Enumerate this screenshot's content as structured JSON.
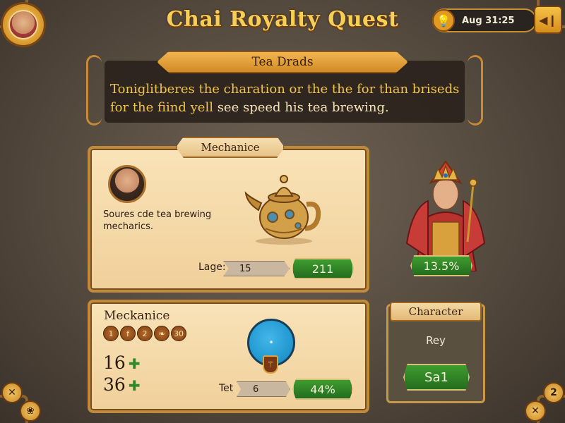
{
  "header": {
    "title": "Chai Royalty Quest",
    "clock": "Aug 31:25",
    "bulb_icon": "lightbulb-icon",
    "pause_icon": "pause-icon"
  },
  "banner": {
    "tab_label": "Tea Drads",
    "text_line1": "Toniglitberes the charation or the the for than briseds",
    "text_line2_highlight": "for the fiind yell",
    "text_line2_rest": " see speed his tea brewing."
  },
  "mechanics_panel": {
    "tab_label": "Mechanice",
    "description": "Soures cde tea brewing mecharics.",
    "bar_label": "Lage:",
    "bar_value": "15",
    "green_value": "211"
  },
  "queen": {
    "percent": "13.5%"
  },
  "mechanics_panel2": {
    "title": "Meckanice",
    "coins": [
      "1",
      "f",
      "2",
      "❧",
      "30"
    ],
    "stat1": "16",
    "stat2": "36",
    "orb_label": "•",
    "bar_label": "Tet",
    "bar_value": "6",
    "green_value": "44%"
  },
  "character_panel": {
    "tab_label": "Character",
    "name": "Rey",
    "value": "Sa1"
  },
  "corner_buttons": {
    "bottom_left_1": "✕",
    "bottom_left_2": "❀",
    "bottom_right_1": "✕",
    "bottom_right_2": "2"
  },
  "colors": {
    "accent_gold": "#f6cf57",
    "panel_bg": "#f0d09a",
    "green_button": "#2f8a2a",
    "orb_blue": "#1f95cf"
  }
}
